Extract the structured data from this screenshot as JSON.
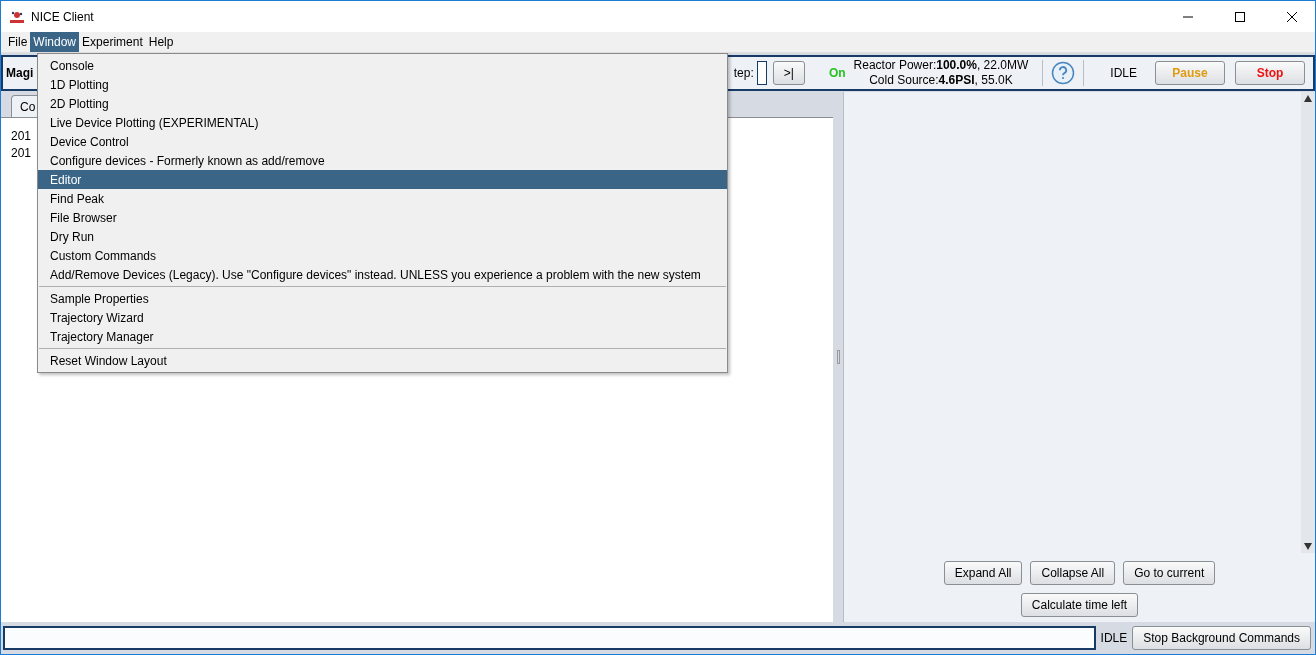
{
  "window": {
    "title": "NICE Client"
  },
  "menubar": [
    {
      "label": "File",
      "selected": false
    },
    {
      "label": "Window",
      "selected": true
    },
    {
      "label": "Experiment",
      "selected": false
    },
    {
      "label": "Help",
      "selected": false
    }
  ],
  "menu": {
    "groups": [
      [
        {
          "label": "Console",
          "selected": false
        },
        {
          "label": "1D Plotting",
          "selected": false
        },
        {
          "label": "2D Plotting",
          "selected": false
        },
        {
          "label": "Live Device Plotting (EXPERIMENTAL)",
          "selected": false
        },
        {
          "label": "Device Control",
          "selected": false
        },
        {
          "label": "Configure devices - Formerly known as add/remove",
          "selected": false
        },
        {
          "label": "Editor",
          "selected": true
        },
        {
          "label": "Find Peak",
          "selected": false
        },
        {
          "label": "File Browser",
          "selected": false
        },
        {
          "label": "Dry Run",
          "selected": false
        },
        {
          "label": "Custom Commands",
          "selected": false
        },
        {
          "label": "Add/Remove Devices (Legacy). Use \"Configure devices\" instead. UNLESS you experience a problem with the new system",
          "selected": false
        }
      ],
      [
        {
          "label": "Sample Properties",
          "selected": false
        },
        {
          "label": "Trajectory Wizard",
          "selected": false
        },
        {
          "label": "Trajectory Manager",
          "selected": false
        }
      ],
      [
        {
          "label": "Reset Window Layout",
          "selected": false
        }
      ]
    ]
  },
  "toolbar": {
    "instrument": "Magi",
    "step_label": "tep:",
    "step_button": ">|",
    "reactor_state": "On",
    "reactor_power": "Reactor Power:**100.0%**, 22.0MW",
    "cold_source": "Cold Source:**4.6PSI**, 55.0K",
    "status": "IDLE",
    "pause": "Pause",
    "stop": "Stop"
  },
  "left_panel": {
    "tab": "Co",
    "lines": [
      "201",
      "201"
    ]
  },
  "right_panel": {
    "buttons": [
      "Expand All",
      "Collapse All",
      "Go to current"
    ],
    "calc_button": "Calculate time left"
  },
  "bottom_bar": {
    "status": "IDLE",
    "button": "Stop Background Commands"
  }
}
